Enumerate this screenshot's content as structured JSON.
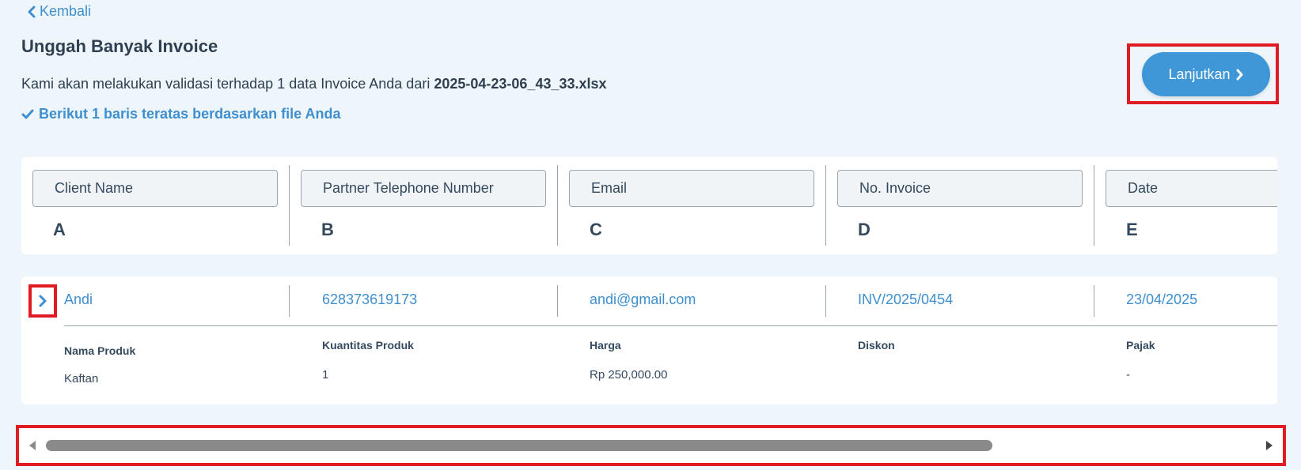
{
  "nav": {
    "back_label": "Kembali"
  },
  "page": {
    "title": "Unggah Banyak Invoice",
    "subtitle_prefix": "Kami akan melakukan validasi terhadap 1 data Invoice Anda dari",
    "file_name": "2025-04-23-06_43_33.xlsx",
    "hint": "Berikut 1 baris teratas berdasarkan file Anda"
  },
  "actions": {
    "continue_label": "Lanjutkan"
  },
  "columns": [
    {
      "header": "Client Name",
      "letter": "A"
    },
    {
      "header": "Partner Telephone Number",
      "letter": "B"
    },
    {
      "header": "Email",
      "letter": "C"
    },
    {
      "header": "No. Invoice",
      "letter": "D"
    },
    {
      "header": "Date",
      "letter": "E"
    }
  ],
  "row": {
    "cells": [
      "Andi",
      "628373619173",
      "andi@gmail.com",
      "INV/2025/0454",
      "23/04/2025"
    ],
    "details": [
      {
        "label": "Nama Produk",
        "value": "Kaftan"
      },
      {
        "label": "Kuantitas Produk",
        "value": "1"
      },
      {
        "label": "Harga",
        "value": "Rp 250,000.00"
      },
      {
        "label": "Diskon",
        "value": ""
      },
      {
        "label": "Pajak",
        "value": "-"
      }
    ]
  },
  "colors": {
    "accent": "#3f97d8",
    "link": "#3d8fcf",
    "highlight": "#e01b24",
    "text": "#34495e",
    "background": "#eff6fb"
  }
}
